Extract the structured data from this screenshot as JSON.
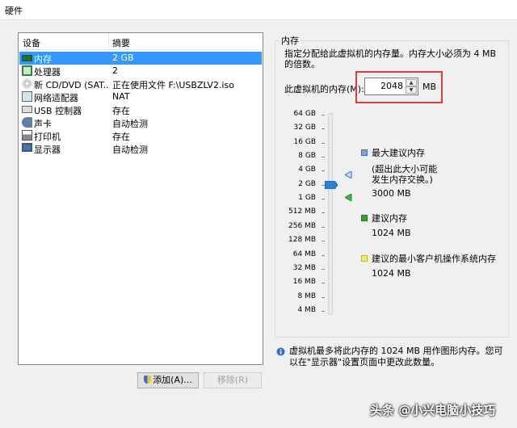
{
  "window": {
    "title": "硬件"
  },
  "device_list": {
    "columns": [
      "设备",
      "摘要"
    ],
    "rows": [
      {
        "name": "内存",
        "summary": "2 GB",
        "icon": "memory-icon",
        "selected": true
      },
      {
        "name": "处理器",
        "summary": "2",
        "icon": "cpu-icon"
      },
      {
        "name": "新 CD/DVD (SAT...",
        "summary": "正在使用文件 F:\\USBZLV2.iso",
        "icon": "cd-icon"
      },
      {
        "name": "网络适配器",
        "summary": "NAT",
        "icon": "network-icon"
      },
      {
        "name": "USB 控制器",
        "summary": "存在",
        "icon": "usb-icon"
      },
      {
        "name": "声卡",
        "summary": "自动检测",
        "icon": "sound-icon"
      },
      {
        "name": "打印机",
        "summary": "存在",
        "icon": "printer-icon"
      },
      {
        "name": "显示器",
        "summary": "自动检测",
        "icon": "monitor-icon"
      }
    ]
  },
  "buttons": {
    "add": "添加(A)...",
    "remove": "移除(R)"
  },
  "memory": {
    "group_title": "内存",
    "description": "指定分配给此虚拟机的内存量。内存大小必须为 4 MB 的倍数。",
    "label": "此虚拟机的内存(M):",
    "value": "2048",
    "unit": "MB",
    "scale": [
      "64 GB",
      "32 GB",
      "16 GB",
      "8 GB",
      "4 GB",
      "2 GB",
      "1 GB",
      "512 MB",
      "256 MB",
      "128 MB",
      "64 MB",
      "32 MB",
      "16 MB",
      "8 MB",
      "4 MB"
    ],
    "legend": [
      {
        "title": "最大建议内存",
        "note": "(超出此大小可能发生内存交换。)",
        "value": "3000 MB",
        "color": "#3b6fc4"
      },
      {
        "title": "建议内存",
        "value": "1024 MB",
        "color": "#2fa52f"
      },
      {
        "title": "建议的最小客户机操作系统内存",
        "value": "1024 MB",
        "color": "#e8e83a"
      }
    ],
    "info": "虚拟机最多将此内存的 1024 MB 用作图形内存。您可以在\"显示器\"设置页面中更改此数量。"
  },
  "watermark": "头条 @小兴电脑小技巧"
}
